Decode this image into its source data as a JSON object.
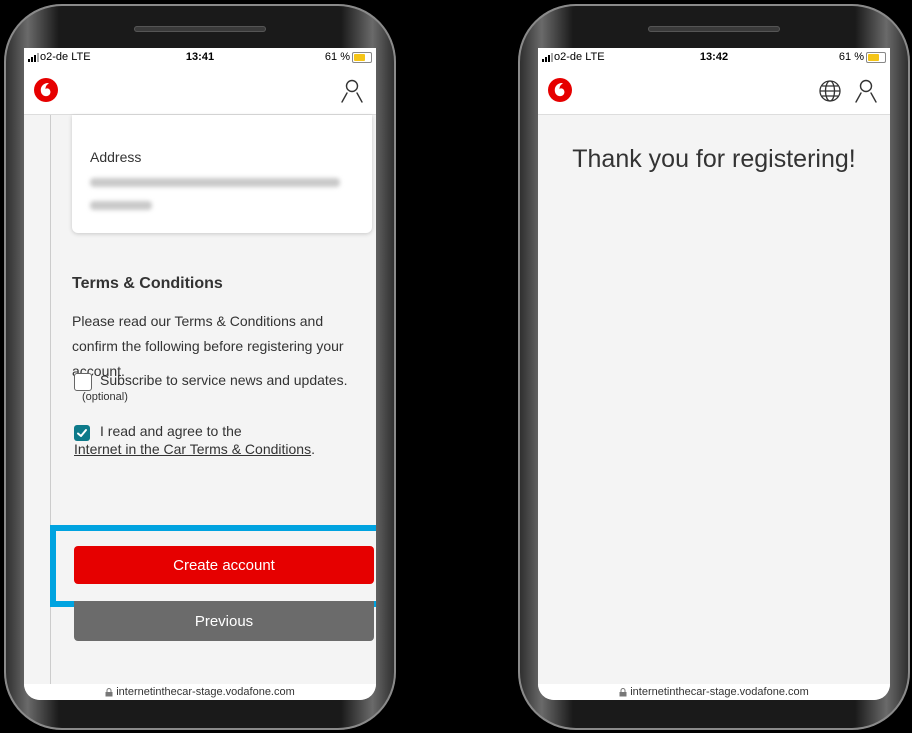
{
  "left_screen": {
    "status": {
      "carrier": "o2-de  LTE",
      "time": "13:41",
      "battery": "61 %",
      "battery_level": 0.61
    },
    "address_card": {
      "label": "Address"
    },
    "terms": {
      "heading": "Terms & Conditions",
      "body": "Please read our Terms & Conditions and confirm the following before registering your account.",
      "subscribe_label": "Subscribe to service news and updates.",
      "subscribe_optional": "(optional)",
      "subscribe_checked": false,
      "agree_prefix": "I read and agree to the",
      "agree_link": "Internet in the Car Terms & Conditions",
      "agree_suffix": ".",
      "agree_checked": true
    },
    "buttons": {
      "create": "Create account",
      "previous": "Previous"
    },
    "url": "internetinthecar-stage.vodafone.com"
  },
  "right_screen": {
    "status": {
      "carrier": "o2-de  LTE",
      "time": "13:42",
      "battery": "61 %",
      "battery_level": 0.61
    },
    "message": "Thank you for registering!",
    "url": "internetinthecar-stage.vodafone.com"
  },
  "colors": {
    "brand_red": "#e60000",
    "highlight": "#00a3e0",
    "checkbox": "#0d7a8a",
    "secondary": "#6b6b6b"
  },
  "icons": [
    "vodafone-logo",
    "user-icon",
    "globe-icon",
    "lock-icon",
    "check-icon"
  ]
}
